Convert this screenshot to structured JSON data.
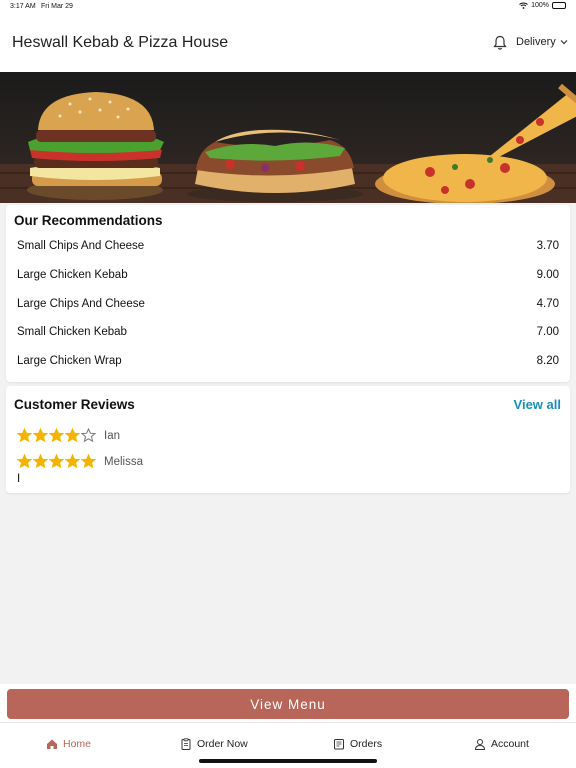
{
  "status_bar": {
    "time": "3:17 AM",
    "date": "Fri Mar 29",
    "battery": "100%"
  },
  "header": {
    "title": "Heswall Kebab & Pizza House",
    "mode": "Delivery"
  },
  "recommendations": {
    "title": "Our Recommendations",
    "items": [
      {
        "name": "Small Chips And Cheese",
        "price": "3.70"
      },
      {
        "name": "Large Chicken Kebab",
        "price": "9.00"
      },
      {
        "name": "Large Chips And Cheese",
        "price": "4.70"
      },
      {
        "name": "Small Chicken Kebab",
        "price": "7.00"
      },
      {
        "name": "Large Chicken Wrap",
        "price": "8.20"
      }
    ]
  },
  "reviews": {
    "title": "Customer Reviews",
    "view_all": "View all",
    "items": [
      {
        "name": "Ian",
        "rating": 4
      },
      {
        "name": "Melissa",
        "rating": 5,
        "text": "I"
      }
    ]
  },
  "view_menu": "View Menu",
  "tabs": [
    {
      "label": "Home",
      "icon": "home-icon",
      "active": true
    },
    {
      "label": "Order Now",
      "icon": "clipboard-icon"
    },
    {
      "label": "Orders",
      "icon": "receipt-icon"
    },
    {
      "label": "Account",
      "icon": "user-icon"
    }
  ],
  "colors": {
    "accent": "#b9665a",
    "link": "#1a8fb8",
    "star": "#f5b400"
  }
}
